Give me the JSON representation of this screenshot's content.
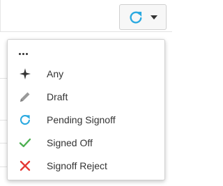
{
  "toolbar": {
    "status_filter_button": {
      "icon": "refresh-icon",
      "caret_icon": "caret-down-icon",
      "color": "#2aa9e0"
    }
  },
  "menu": {
    "more_icon": "ellipsis-icon",
    "items": [
      {
        "label": "Any",
        "icon": "plus-star-icon",
        "color": "#333333"
      },
      {
        "label": "Draft",
        "icon": "pencil-icon",
        "color": "#999999"
      },
      {
        "label": "Pending Signoff",
        "icon": "refresh-icon",
        "color": "#2aa9e0"
      },
      {
        "label": "Signed Off",
        "icon": "check-icon",
        "color": "#4caf50"
      },
      {
        "label": "Signoff Reject",
        "icon": "x-icon",
        "color": "#e53935"
      }
    ]
  }
}
